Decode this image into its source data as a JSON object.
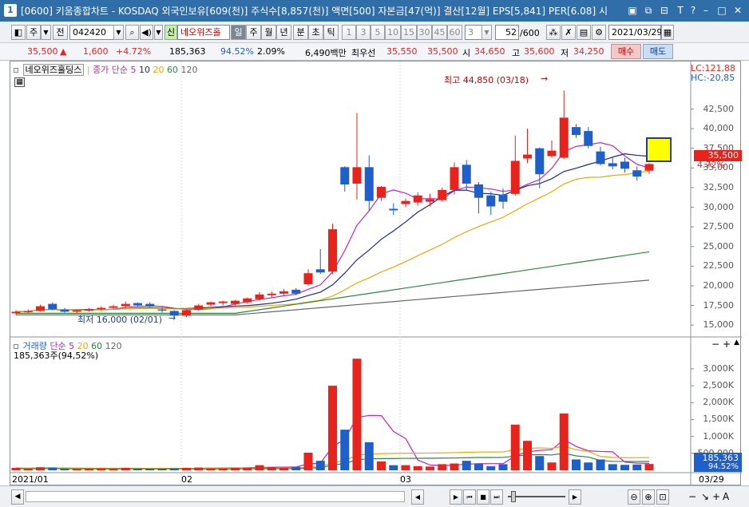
{
  "window": {
    "number": "1",
    "title": "[0600] 키움종합차트 - KOSDAQ 외국인보유[609(천)] 주식수[8,857(천)] 액면[500] 자본금[47(억)] 결산[12월] EPS[5,841] PER[6.08] 시"
  },
  "toolbar": {
    "period_type": "주",
    "market": "전",
    "stock_code": "042420",
    "stock_badge": "신",
    "stock_name": "네오위즈홀",
    "period_tabs": [
      "일",
      "주",
      "월",
      "년",
      "분",
      "초",
      "틱"
    ],
    "minute_options": [
      "1",
      "3",
      "5",
      "10",
      "15",
      "30",
      "45",
      "60"
    ],
    "custom_period": "3",
    "count": "52",
    "count_max": "/600",
    "date": "2021/03/29"
  },
  "quote": {
    "price": "35,500",
    "change": "1,600",
    "change_pct": "+4.72%",
    "volume": "185,363",
    "volume_pct": "94.52%",
    "turnover": "2.09%",
    "amount": "6,490백만",
    "best_bid_label": "최우선",
    "ask": "35,550",
    "bid": "35,500",
    "open_label": "시",
    "open": "34,650",
    "high_label": "고",
    "high": "35,600",
    "low_label": "저",
    "low": "34,250",
    "buy": "매수",
    "sell": "매도"
  },
  "legend": {
    "stock_name": "네오위즈홀딩스",
    "price_ma_label": "종가 단순",
    "ma_periods": [
      "5",
      "10",
      "20",
      "60",
      "120"
    ],
    "volume_label": "거래량",
    "volume_ma_label": "단순",
    "volume_ma_periods": [
      "5",
      "20",
      "60",
      "120"
    ],
    "volume_value": "185,363주(94,52%)",
    "lc": "LC:121,88",
    "hc": "HC:-20,85"
  },
  "annotations": {
    "high": "최고 44,850 (03/18)",
    "low": "최저 16,000 (02/01)"
  },
  "price_axis": [
    "42,500",
    "40,000",
    "37,500",
    "35,000",
    "32,500",
    "30,000",
    "27,500",
    "25,000",
    "22,500",
    "20,000",
    "17,500",
    "15,000"
  ],
  "price_tag": "35,500",
  "price_pct_tag": "4.72%",
  "volume_axis": [
    "3,000K",
    "2,500K",
    "2,000K",
    "1,500K",
    "1,000K",
    "500,000"
  ],
  "volume_tag": "185,363",
  "volume_pct_tag": "94.52%",
  "x_axis": [
    "2021/01",
    "02",
    "03",
    "03/29"
  ],
  "colors": {
    "up": "#e8231c",
    "down": "#1f5fc9",
    "ma5": "#c322c3",
    "ma10": "#1a2a8c",
    "ma20": "#f0a800",
    "ma60": "#2a8a3a",
    "ma120": "#666666"
  },
  "chart_data": {
    "type": "candlestick",
    "ylim": [
      14000,
      45500
    ],
    "volume_ylim": [
      0,
      3400000
    ],
    "candles": [
      {
        "o": 16500,
        "h": 16900,
        "l": 16300,
        "c": 16700,
        "v": 70000
      },
      {
        "o": 16700,
        "h": 17000,
        "l": 16500,
        "c": 16800,
        "v": 50000
      },
      {
        "o": 16800,
        "h": 17600,
        "l": 16700,
        "c": 17400,
        "v": 90000
      },
      {
        "o": 17700,
        "h": 17900,
        "l": 16900,
        "c": 17000,
        "v": 80000
      },
      {
        "o": 17000,
        "h": 17200,
        "l": 16600,
        "c": 16700,
        "v": 40000
      },
      {
        "o": 16700,
        "h": 17000,
        "l": 16500,
        "c": 16900,
        "v": 40000
      },
      {
        "o": 16900,
        "h": 17200,
        "l": 16700,
        "c": 17000,
        "v": 50000
      },
      {
        "o": 17000,
        "h": 17400,
        "l": 16800,
        "c": 17200,
        "v": 60000
      },
      {
        "o": 17200,
        "h": 17600,
        "l": 17000,
        "c": 17400,
        "v": 50000
      },
      {
        "o": 17400,
        "h": 18000,
        "l": 17200,
        "c": 17700,
        "v": 70000
      },
      {
        "o": 17800,
        "h": 17900,
        "l": 17300,
        "c": 17500,
        "v": 50000
      },
      {
        "o": 17700,
        "h": 17900,
        "l": 17300,
        "c": 17400,
        "v": 40000
      },
      {
        "o": 17000,
        "h": 17300,
        "l": 16600,
        "c": 16900,
        "v": 40000
      },
      {
        "o": 16800,
        "h": 16900,
        "l": 16000,
        "c": 16200,
        "v": 60000
      },
      {
        "o": 16200,
        "h": 17000,
        "l": 16000,
        "c": 16900,
        "v": 70000
      },
      {
        "o": 17000,
        "h": 17700,
        "l": 16800,
        "c": 17500,
        "v": 80000
      },
      {
        "o": 17600,
        "h": 18000,
        "l": 17400,
        "c": 17900,
        "v": 60000
      },
      {
        "o": 17800,
        "h": 18100,
        "l": 17500,
        "c": 18000,
        "v": 60000
      },
      {
        "o": 17700,
        "h": 18200,
        "l": 17500,
        "c": 18100,
        "v": 70000
      },
      {
        "o": 17900,
        "h": 18500,
        "l": 17700,
        "c": 18400,
        "v": 80000
      },
      {
        "o": 18300,
        "h": 19200,
        "l": 18100,
        "c": 18900,
        "v": 150000
      },
      {
        "o": 18800,
        "h": 19300,
        "l": 18500,
        "c": 19000,
        "v": 90000
      },
      {
        "o": 19000,
        "h": 19600,
        "l": 18800,
        "c": 19300,
        "v": 70000
      },
      {
        "o": 19500,
        "h": 19700,
        "l": 18800,
        "c": 19000,
        "v": 100000
      },
      {
        "o": 20200,
        "h": 22100,
        "l": 20000,
        "c": 21600,
        "v": 520000
      },
      {
        "o": 22100,
        "h": 24700,
        "l": 21500,
        "c": 21700,
        "v": 280000
      },
      {
        "o": 21800,
        "h": 27900,
        "l": 21500,
        "c": 27200,
        "v": 2500000
      },
      {
        "o": 35100,
        "h": 35200,
        "l": 32000,
        "c": 32900,
        "v": 1200000
      },
      {
        "o": 33000,
        "h": 42000,
        "l": 31000,
        "c": 35100,
        "v": 3300000
      },
      {
        "o": 35100,
        "h": 36600,
        "l": 29600,
        "c": 30800,
        "v": 830000
      },
      {
        "o": 31200,
        "h": 32700,
        "l": 30800,
        "c": 32600,
        "v": 260000
      },
      {
        "o": 29800,
        "h": 30500,
        "l": 29000,
        "c": 29600,
        "v": 150000
      },
      {
        "o": 30400,
        "h": 31100,
        "l": 30000,
        "c": 30800,
        "v": 150000
      },
      {
        "o": 30600,
        "h": 31900,
        "l": 30200,
        "c": 31500,
        "v": 120000
      },
      {
        "o": 30700,
        "h": 31700,
        "l": 30100,
        "c": 31000,
        "v": 110000
      },
      {
        "o": 30900,
        "h": 32500,
        "l": 30700,
        "c": 32200,
        "v": 180000
      },
      {
        "o": 32200,
        "h": 35700,
        "l": 31600,
        "c": 35100,
        "v": 200000
      },
      {
        "o": 35400,
        "h": 36000,
        "l": 32200,
        "c": 33000,
        "v": 280000
      },
      {
        "o": 32900,
        "h": 33200,
        "l": 29200,
        "c": 31200,
        "v": 200000
      },
      {
        "o": 31500,
        "h": 32000,
        "l": 29000,
        "c": 30100,
        "v": 120000
      },
      {
        "o": 31600,
        "h": 32400,
        "l": 29800,
        "c": 30700,
        "v": 180000
      },
      {
        "o": 31700,
        "h": 39100,
        "l": 31500,
        "c": 35900,
        "v": 1350000
      },
      {
        "o": 36200,
        "h": 40000,
        "l": 35600,
        "c": 36700,
        "v": 870000
      },
      {
        "o": 37500,
        "h": 37600,
        "l": 32400,
        "c": 34200,
        "v": 420000
      },
      {
        "o": 36500,
        "h": 38500,
        "l": 36300,
        "c": 37200,
        "v": 230000
      },
      {
        "o": 36300,
        "h": 44850,
        "l": 36100,
        "c": 41400,
        "v": 1680000
      },
      {
        "o": 40200,
        "h": 40600,
        "l": 38800,
        "c": 39200,
        "v": 320000
      },
      {
        "o": 39700,
        "h": 40200,
        "l": 37500,
        "c": 37800,
        "v": 230000
      },
      {
        "o": 37100,
        "h": 37700,
        "l": 35300,
        "c": 35500,
        "v": 320000
      },
      {
        "o": 35600,
        "h": 36400,
        "l": 34800,
        "c": 35200,
        "v": 180000
      },
      {
        "o": 35800,
        "h": 36300,
        "l": 34400,
        "c": 34900,
        "v": 160000
      },
      {
        "o": 34700,
        "h": 35200,
        "l": 33400,
        "c": 33900,
        "v": 170000
      },
      {
        "o": 34650,
        "h": 35600,
        "l": 34250,
        "c": 35500,
        "v": 185363
      }
    ]
  }
}
